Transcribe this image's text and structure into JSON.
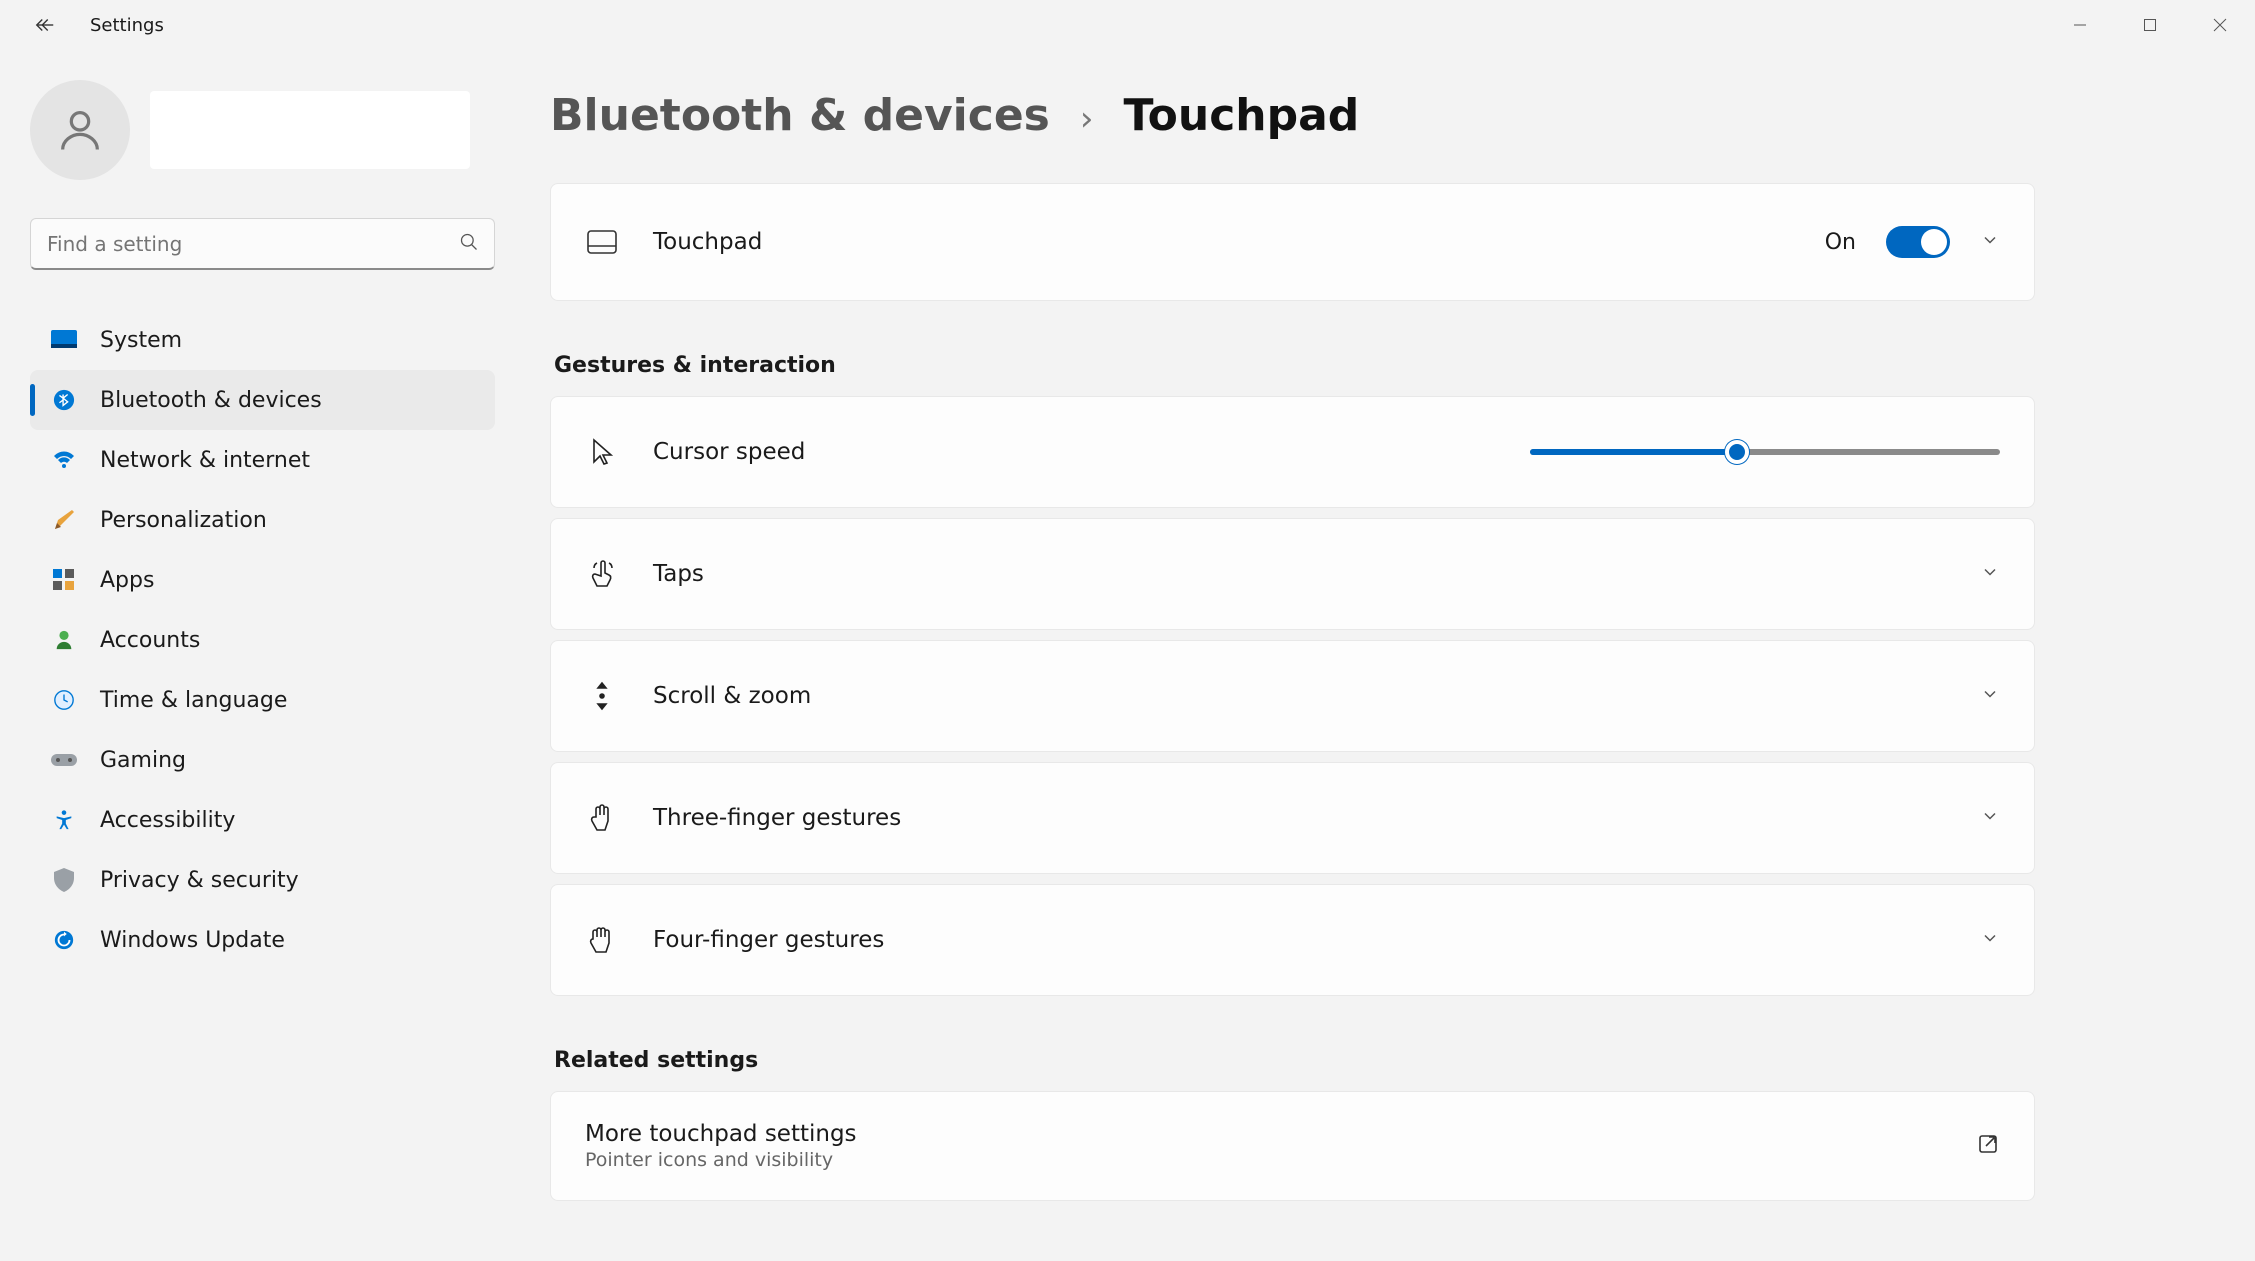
{
  "window": {
    "title": "Settings"
  },
  "search": {
    "placeholder": "Find a setting"
  },
  "nav": {
    "items": [
      {
        "label": "System"
      },
      {
        "label": "Bluetooth & devices"
      },
      {
        "label": "Network & internet"
      },
      {
        "label": "Personalization"
      },
      {
        "label": "Apps"
      },
      {
        "label": "Accounts"
      },
      {
        "label": "Time & language"
      },
      {
        "label": "Gaming"
      },
      {
        "label": "Accessibility"
      },
      {
        "label": "Privacy & security"
      },
      {
        "label": "Windows Update"
      }
    ],
    "selected_index": 1
  },
  "breadcrumb": {
    "parent": "Bluetooth & devices",
    "current": "Touchpad"
  },
  "cards": {
    "touchpad": {
      "title": "Touchpad",
      "state_label": "On",
      "state": true
    },
    "gestures_heading": "Gestures & interaction",
    "cursor_speed": {
      "title": "Cursor speed",
      "value_pct": 44
    },
    "taps": {
      "title": "Taps"
    },
    "scroll_zoom": {
      "title": "Scroll & zoom"
    },
    "three_finger": {
      "title": "Three-finger gestures"
    },
    "four_finger": {
      "title": "Four-finger gestures"
    },
    "related_heading": "Related settings",
    "more": {
      "title": "More touchpad settings",
      "subtitle": "Pointer icons and visibility"
    }
  },
  "colors": {
    "accent": "#0067c0"
  }
}
